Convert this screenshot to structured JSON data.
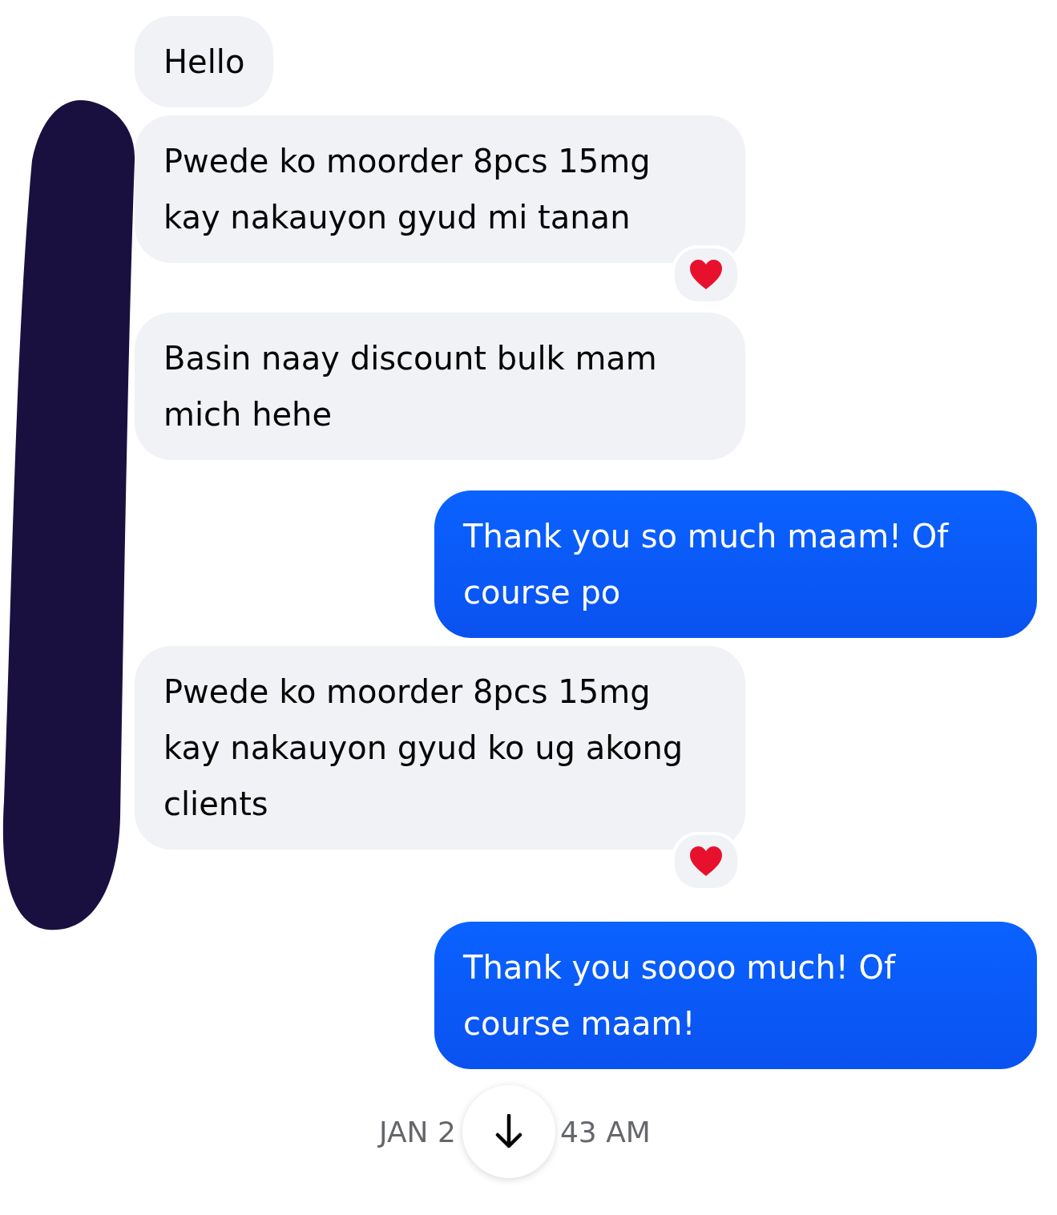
{
  "messages": [
    {
      "kind": "received",
      "text": "Hello",
      "reaction": false
    },
    {
      "kind": "received",
      "text": "Pwede ko moorder 8pcs 15mg kay nakauyon gyud mi tanan",
      "reaction": true
    },
    {
      "kind": "received",
      "text": "Basin naay discount bulk mam mich hehe",
      "reaction": false
    },
    {
      "kind": "sent",
      "text": "Thank you so much maam! Of course po",
      "reaction": false
    },
    {
      "kind": "received",
      "text": "Pwede ko moorder 8pcs 15mg kay nakauyon gyud ko ug akong clients",
      "reaction": true
    },
    {
      "kind": "sent",
      "text": "Thank you soooo much! Of course maam!",
      "reaction": false
    }
  ],
  "timestamp": {
    "left": "JAN 2",
    "right": "43 AM"
  }
}
